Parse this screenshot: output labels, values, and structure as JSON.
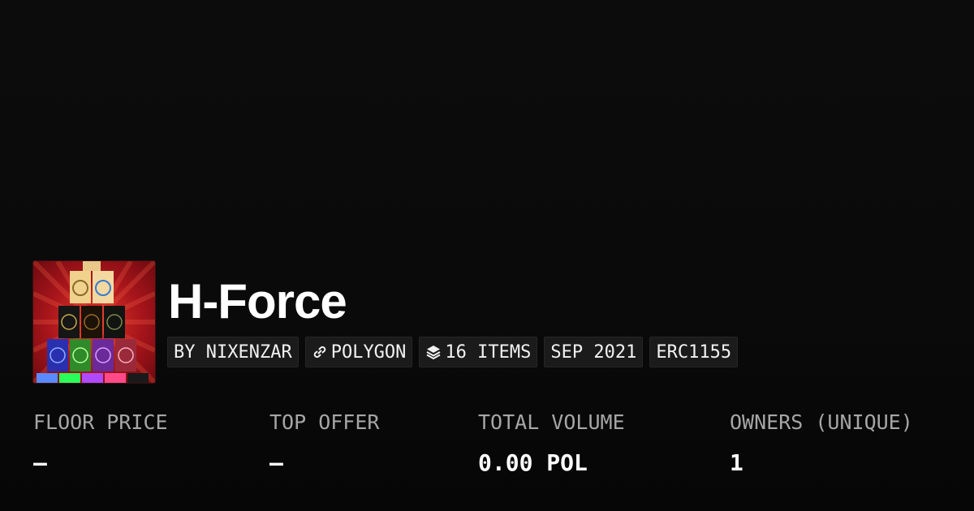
{
  "collection": {
    "name": "H-Force",
    "thumbnail_icon": "collection-thumbnail-image"
  },
  "tags": {
    "creator": "BY NIXENZAR",
    "chain": "POLYGON",
    "chain_icon": "link-icon",
    "items": "16 ITEMS",
    "items_icon": "layers-icon",
    "date": "SEP 2021",
    "standard": "ERC1155"
  },
  "stats": {
    "floor_price": {
      "label": "FLOOR PRICE",
      "value": "–"
    },
    "top_offer": {
      "label": "TOP OFFER",
      "value": "–"
    },
    "total_volume": {
      "label": "TOTAL VOLUME",
      "value": "0.00 POL"
    },
    "owners": {
      "label": "OWNERS (UNIQUE)",
      "value": "1"
    }
  },
  "colors": {
    "background": "#0a0a0a",
    "tag_background": "#1b1b1b",
    "label_gray": "#a6a6a6",
    "text": "#ffffff"
  }
}
